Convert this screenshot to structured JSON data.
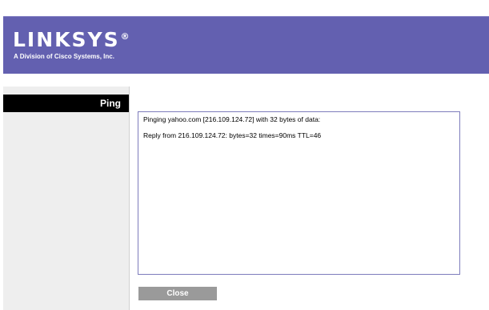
{
  "header": {
    "logo_text": "LINKSYS",
    "logo_mark": "®",
    "tagline": "A Division of Cisco Systems, Inc."
  },
  "sidebar": {
    "title": "Ping"
  },
  "output": {
    "lines": [
      "Pinging yahoo.com [216.109.124.72] with 32 bytes of data:",
      "Reply from 216.109.124.72: bytes=32 times=90ms TTL=46"
    ]
  },
  "buttons": {
    "close_label": "Close"
  },
  "colors": {
    "header_bg": "#6360b0",
    "sidebar_title_bg": "#000000",
    "sidebar_bg": "#eeeeee",
    "output_border": "#7e7cbc",
    "button_bg": "#9a9a9a"
  }
}
